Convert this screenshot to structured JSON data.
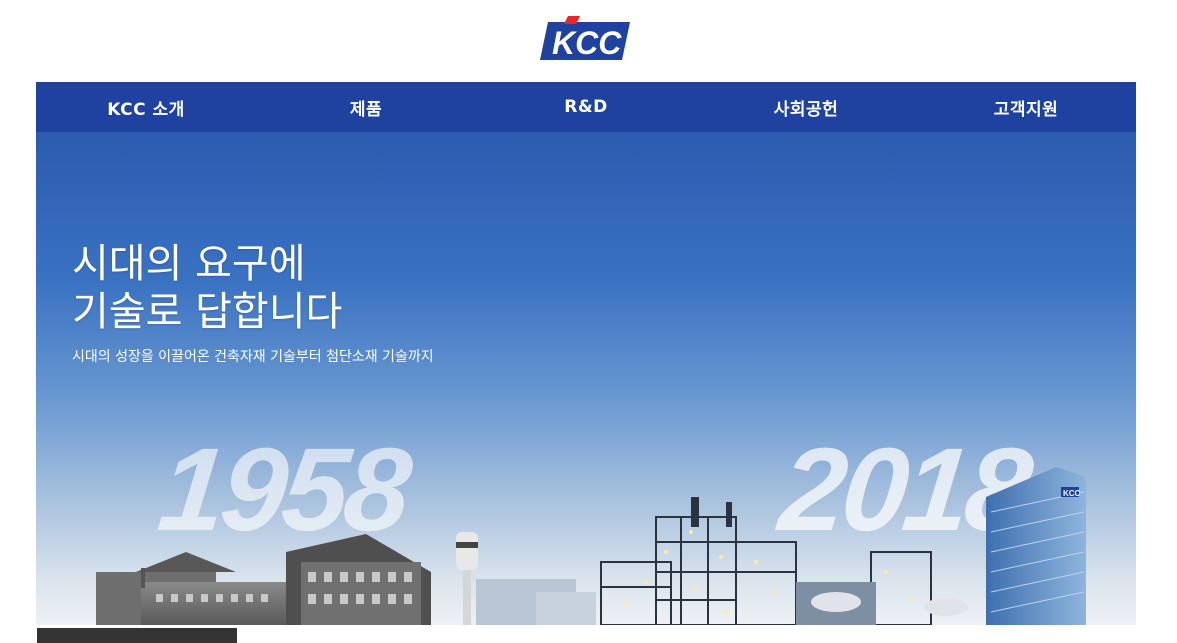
{
  "brand": {
    "logo_text": "KCC",
    "color": "#1f42a0",
    "accent": "#e5262b"
  },
  "nav": {
    "items": [
      {
        "label": "KCC 소개"
      },
      {
        "label": "제품"
      },
      {
        "label": "R&D"
      },
      {
        "label": "사회공헌"
      },
      {
        "label": "고객지원"
      }
    ]
  },
  "hero": {
    "headline_line1": "시대의 요구에",
    "headline_line2": "기술로 답합니다",
    "subtitle": "시대의 성장을 이끌어온 건축자재 기술부터 첨단소재 기술까지",
    "year_start": "1958",
    "year_end": "2018",
    "building_sign": "KCC"
  }
}
